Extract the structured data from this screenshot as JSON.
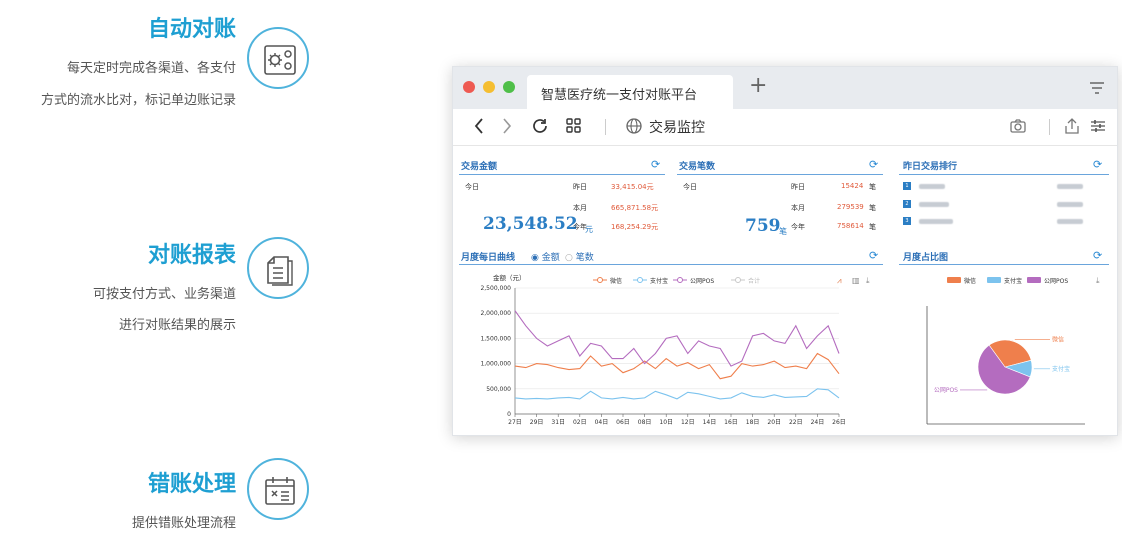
{
  "features": [
    {
      "title": "自动对账",
      "desc": [
        "每天定时完成各渠道、各支付",
        "方式的流水比对，标记单边账记录"
      ],
      "icon": "settings-grid-icon"
    },
    {
      "title": "对账报表",
      "desc": [
        "可按支付方式、业务渠道",
        "进行对账结果的展示"
      ],
      "icon": "document-icon"
    },
    {
      "title": "错账处理",
      "desc": [
        "提供错账处理流程"
      ],
      "icon": "calendar-icon"
    }
  ],
  "browser": {
    "tab_title": "智慧医疗统一支付对账平台",
    "new_tab": "+",
    "address": "交易监控"
  },
  "panels": {
    "amount": {
      "title": "交易金额",
      "today_label": "今日",
      "today_value": "23,548.52",
      "today_unit": "元",
      "rows": [
        {
          "label": "昨日",
          "value": "33,415.04元"
        },
        {
          "label": "本月",
          "value": "665,871.58元"
        },
        {
          "label": "今年",
          "value": "168,254.29元"
        }
      ]
    },
    "count": {
      "title": "交易笔数",
      "today_label": "今日",
      "today_value": "759",
      "today_unit": "笔",
      "rows": [
        {
          "label": "昨日",
          "value": "15424",
          "unit": "笔"
        },
        {
          "label": "本月",
          "value": "279539",
          "unit": "笔"
        },
        {
          "label": "今年",
          "value": "758614",
          "unit": "笔"
        }
      ]
    },
    "ranking": {
      "title": "昨日交易排行",
      "items": [
        {
          "rank": "1"
        },
        {
          "rank": "2"
        },
        {
          "rank": "3"
        }
      ]
    },
    "daily": {
      "title": "月度每日曲线",
      "radio_amount": "金额",
      "radio_count": "笔数"
    },
    "ratio": {
      "title": "月度占比图"
    }
  },
  "chart_data": [
    {
      "type": "line",
      "ylabel": "金额（元）",
      "ylim": [
        0,
        2500000
      ],
      "yticks": [
        "0",
        "500,000",
        "1,000,000",
        "1,500,000",
        "2,000,000",
        "2,500,000"
      ],
      "x": [
        "27日",
        "28日",
        "29日",
        "30日",
        "31日",
        "01日",
        "02日",
        "03日",
        "04日",
        "05日",
        "06日",
        "07日",
        "08日",
        "09日",
        "10日",
        "11日",
        "12日",
        "13日",
        "14日",
        "15日",
        "16日",
        "17日",
        "18日",
        "19日",
        "20日",
        "21日",
        "22日",
        "23日",
        "24日",
        "25日",
        "26日"
      ],
      "xticks": [
        "27日",
        "29日",
        "31日",
        "02日",
        "04日",
        "06日",
        "08日",
        "10日",
        "12日",
        "14日",
        "16日",
        "18日",
        "20日",
        "22日",
        "24日",
        "26日"
      ],
      "series": [
        {
          "name": "微信",
          "color": "#ef7f4c",
          "values": [
            950000,
            920000,
            1000000,
            980000,
            920000,
            880000,
            900000,
            1150000,
            950000,
            1000000,
            820000,
            900000,
            1050000,
            900000,
            1100000,
            950000,
            1020000,
            900000,
            980000,
            700000,
            750000,
            1000000,
            950000,
            980000,
            1050000,
            920000,
            950000,
            900000,
            1200000,
            1080000,
            800000
          ]
        },
        {
          "name": "支付宝",
          "color": "#7cc3ee",
          "values": [
            320000,
            300000,
            310000,
            300000,
            320000,
            330000,
            300000,
            450000,
            320000,
            300000,
            330000,
            300000,
            320000,
            450000,
            380000,
            300000,
            430000,
            400000,
            350000,
            300000,
            320000,
            420000,
            350000,
            330000,
            380000,
            330000,
            340000,
            350000,
            500000,
            480000,
            320000
          ]
        },
        {
          "name": "公网POS",
          "color": "#b46cbf",
          "values": [
            2050000,
            1750000,
            1500000,
            1350000,
            1450000,
            1550000,
            1150000,
            1400000,
            1350000,
            1100000,
            1100000,
            1300000,
            1000000,
            1200000,
            1500000,
            1550000,
            1200000,
            1450000,
            1350000,
            1300000,
            950000,
            1050000,
            1550000,
            1600000,
            1450000,
            1400000,
            1750000,
            1300000,
            1550000,
            1750000,
            1200000
          ]
        },
        {
          "name": "合计",
          "color": "#c8c8c8",
          "values": []
        }
      ]
    },
    {
      "type": "pie",
      "series": [
        {
          "name": "微信",
          "color": "#ef7f4c",
          "value": 31
        },
        {
          "name": "支付宝",
          "color": "#7cc3ee",
          "value": 10
        },
        {
          "name": "公网POS",
          "color": "#b46cbf",
          "value": 59
        }
      ]
    }
  ]
}
